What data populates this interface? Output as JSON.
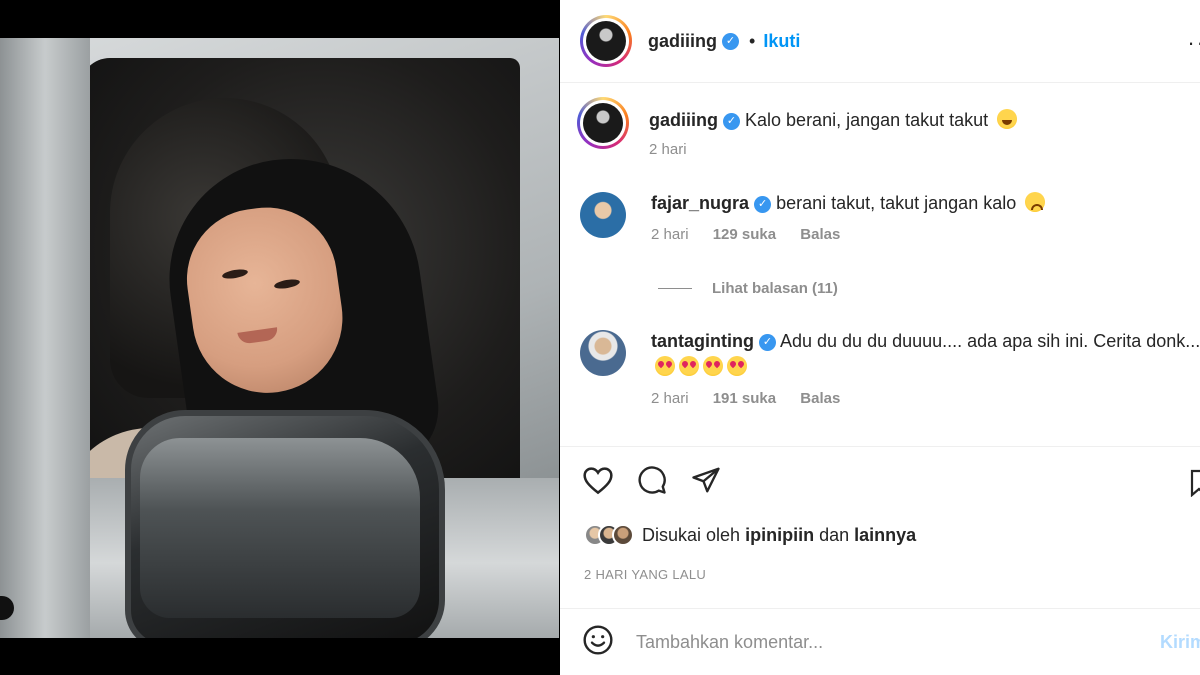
{
  "post": {
    "username": "gadiiing",
    "follow_label": "Ikuti",
    "separator": "•",
    "more_label": "··",
    "verified_glyph": "✓"
  },
  "comments": [
    {
      "username": "gadiiing",
      "text": "Kalo berani, jangan takut takut",
      "emoji": "grin",
      "time": "2 hari",
      "likes": "",
      "reply_label": ""
    },
    {
      "username": "fajar_nugra",
      "text": "berani takut, takut jangan kalo",
      "emoji": "sad",
      "time": "2 hari",
      "likes": "129 suka",
      "reply_label": "Balas"
    },
    {
      "username": "tantaginting",
      "text": "Adu du du du duuuu.... ada apa sih ini. Cerita donk...",
      "emoji": "heart-eyes x4",
      "time": "2 hari",
      "likes": "191 suka",
      "reply_label": "Balas"
    }
  ],
  "view_replies": "Lihat balasan (11)",
  "likes": {
    "prefix": "Disukai oleh",
    "user": "ipinipiin",
    "conj": "dan",
    "others": "lainnya"
  },
  "date": "2 HARI YANG LALU",
  "comment_box": {
    "placeholder": "Tambahkan komentar...",
    "post_label": "Kirim"
  },
  "icons": [
    "heart-icon",
    "comment-icon",
    "share-icon",
    "bookmark-icon",
    "emoji-icon"
  ],
  "colors": {
    "accent": "#0095f6",
    "verified": "#3897f0",
    "muted": "#8e8e8e",
    "text": "#262626"
  }
}
